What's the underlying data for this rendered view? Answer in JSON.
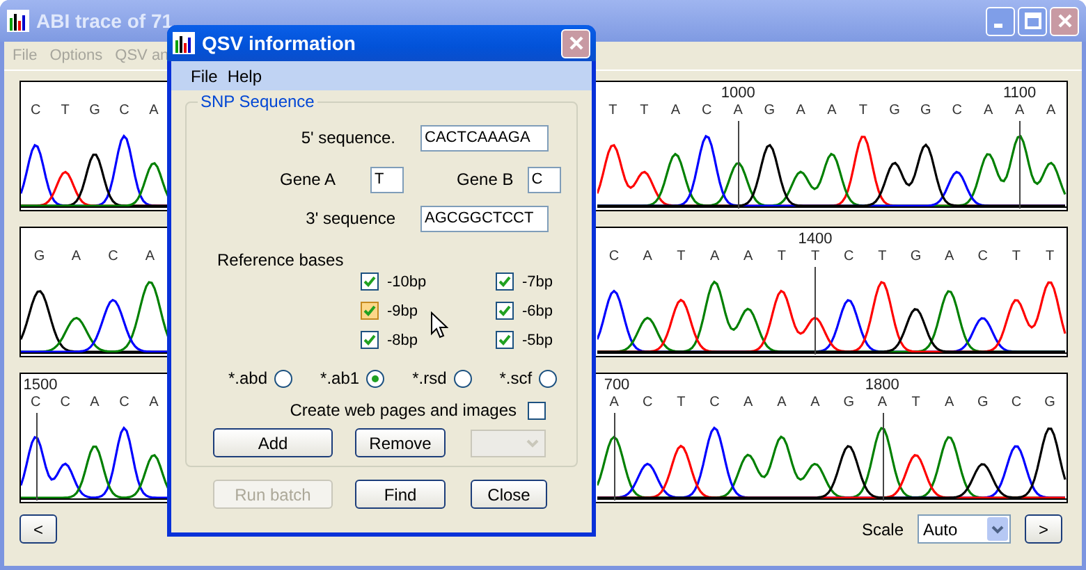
{
  "main_window": {
    "title": "ABI trace of 71",
    "active": false,
    "menu": [
      "File",
      "Options",
      "QSV an"
    ]
  },
  "traces": [
    {
      "left": [
        {
          "base": "C"
        },
        {
          "base": "T"
        },
        {
          "base": "G"
        },
        {
          "base": "C"
        },
        {
          "base": "A"
        }
      ],
      "right": [
        {
          "base": "T"
        },
        {
          "base": "T"
        },
        {
          "base": "A"
        },
        {
          "base": "C"
        },
        {
          "base": "A",
          "mark": "1000"
        },
        {
          "base": "G"
        },
        {
          "base": "A"
        },
        {
          "base": "A"
        },
        {
          "base": "T"
        },
        {
          "base": "G"
        },
        {
          "base": "G"
        },
        {
          "base": "C"
        },
        {
          "base": "A"
        },
        {
          "base": "A",
          "mark": "1100"
        },
        {
          "base": "A"
        }
      ]
    },
    {
      "left": [
        {
          "base": "G"
        },
        {
          "base": "A"
        },
        {
          "base": "C"
        },
        {
          "base": "A"
        }
      ],
      "right": [
        {
          "base": "C"
        },
        {
          "base": "A"
        },
        {
          "base": "T"
        },
        {
          "base": "A"
        },
        {
          "base": "A"
        },
        {
          "base": "T"
        },
        {
          "base": "T",
          "mark": "1400"
        },
        {
          "base": "C"
        },
        {
          "base": "T"
        },
        {
          "base": "G"
        },
        {
          "base": "A"
        },
        {
          "base": "C"
        },
        {
          "base": "T"
        },
        {
          "base": "T"
        }
      ]
    },
    {
      "left": [
        {
          "base": "C",
          "mark": "1500"
        },
        {
          "base": "C"
        },
        {
          "base": "A"
        },
        {
          "base": "C"
        },
        {
          "base": "A"
        }
      ],
      "right": [
        {
          "base": "A",
          "mark": "700"
        },
        {
          "base": "C"
        },
        {
          "base": "T"
        },
        {
          "base": "C"
        },
        {
          "base": "A"
        },
        {
          "base": "A"
        },
        {
          "base": "A"
        },
        {
          "base": "G"
        },
        {
          "base": "A",
          "mark": "1800"
        },
        {
          "base": "T"
        },
        {
          "base": "A"
        },
        {
          "base": "G"
        },
        {
          "base": "C"
        },
        {
          "base": "G"
        }
      ]
    }
  ],
  "nav": {
    "prev": "<",
    "scale_label": "Scale",
    "scale_value": "Auto",
    "next": ">"
  },
  "dialog": {
    "title": "QSV information",
    "menu": [
      "File",
      "Help"
    ],
    "group": "SNP Sequence",
    "five_prime": {
      "label": "5' sequence.",
      "value": "CACTCAAAGA"
    },
    "gene_a": {
      "label": "Gene A",
      "value": "T"
    },
    "gene_b": {
      "label": "Gene B",
      "value": "C"
    },
    "three_prime": {
      "label": "3' sequence",
      "value": "AGCGGCTCCT"
    },
    "reference_label": "Reference bases",
    "reference_bases": [
      {
        "label": "-10bp",
        "checked": true,
        "hovered": false
      },
      {
        "label": "-7bp",
        "checked": true,
        "hovered": false
      },
      {
        "label": "-9bp",
        "checked": true,
        "hovered": true
      },
      {
        "label": "-6bp",
        "checked": true,
        "hovered": false
      },
      {
        "label": "-8bp",
        "checked": true,
        "hovered": false
      },
      {
        "label": "-5bp",
        "checked": true,
        "hovered": false
      }
    ],
    "formats": [
      {
        "label": "*.abd",
        "selected": false
      },
      {
        "label": "*.ab1",
        "selected": true
      },
      {
        "label": "*.rsd",
        "selected": false
      },
      {
        "label": "*.scf",
        "selected": false
      }
    ],
    "web_pages": {
      "label": "Create web pages and images",
      "checked": false
    },
    "list_buttons": [
      {
        "label": "Add",
        "disabled": false
      },
      {
        "label": "Remove",
        "disabled": false
      }
    ],
    "dropdown": {
      "disabled": true
    },
    "actions": [
      {
        "label": "Run batch",
        "disabled": true
      },
      {
        "label": "Find",
        "disabled": false
      },
      {
        "label": "Close",
        "disabled": false
      }
    ]
  }
}
